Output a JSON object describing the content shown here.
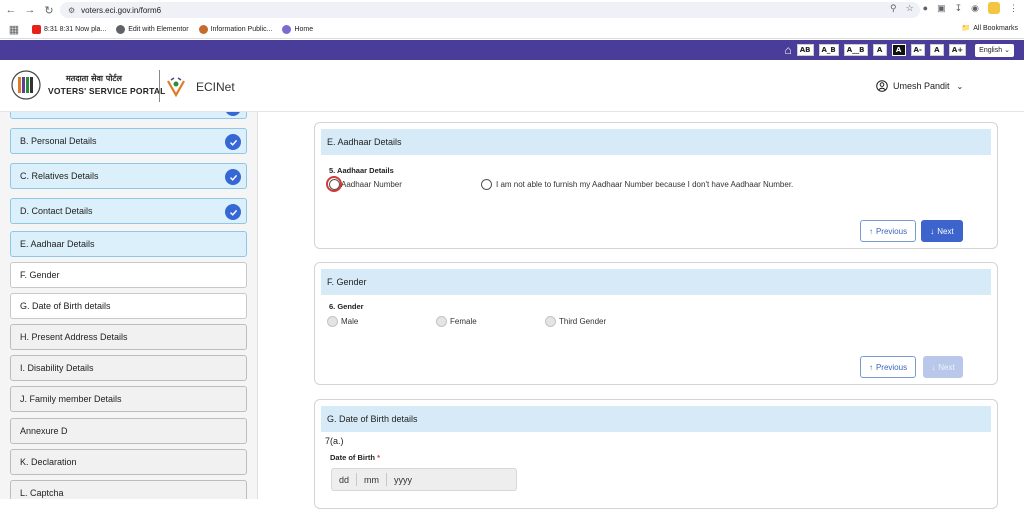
{
  "browser": {
    "url": "voters.eci.gov.in/form6",
    "bookmarks": [
      {
        "label": "8:31 8:31 Now pla...",
        "color": "#e62117"
      },
      {
        "label": "Edit with Elementor",
        "color": "#5f6368"
      },
      {
        "label": "Information Public...",
        "color": "#c56b2b"
      },
      {
        "label": "Home",
        "color": "#7a6bd0"
      }
    ],
    "all_bookmarks": "All Bookmarks"
  },
  "topbar": {
    "a11y_buttons": [
      "AB",
      "A_B",
      "A__B",
      "A",
      "A",
      "A-",
      "A",
      "A+"
    ],
    "language": "English"
  },
  "header": {
    "portal_hindi": "मतदाता सेवा पोर्टल",
    "portal_name": "VOTERS' SERVICE PORTAL",
    "ecinet": "ECINet",
    "user_name": "Umesh Pandit"
  },
  "sidebar": {
    "items": [
      {
        "label": "B. Personal Details",
        "state": "done"
      },
      {
        "label": "C. Relatives Details",
        "state": "done"
      },
      {
        "label": "D. Contact Details",
        "state": "done"
      },
      {
        "label": "E. Aadhaar Details",
        "state": "active"
      },
      {
        "label": "F. Gender",
        "state": "pending"
      },
      {
        "label": "G. Date of Birth details",
        "state": "pending"
      },
      {
        "label": "H. Present Address Details",
        "state": "plain"
      },
      {
        "label": "I. Disability Details",
        "state": "plain"
      },
      {
        "label": "J. Family member Details",
        "state": "plain"
      },
      {
        "label": "Annexure D",
        "state": "plain"
      },
      {
        "label": "K. Declaration",
        "state": "plain"
      },
      {
        "label": "L. Captcha",
        "state": "plain"
      }
    ]
  },
  "aadhaar": {
    "title": "E. Aadhaar Details",
    "question": "5. Aadhaar Details",
    "option1": "Aadhaar Number",
    "option2": "I am not able to furnish my Aadhaar Number because I don't have Aadhaar Number.",
    "prev": "Previous",
    "next": "Next"
  },
  "gender": {
    "title": "F. Gender",
    "question": "6. Gender",
    "options": [
      "Male",
      "Female",
      "Third Gender"
    ],
    "prev": "Previous",
    "next": "Next"
  },
  "dob": {
    "title": "G. Date of Birth details",
    "section_no": "7(a.)",
    "label": "Date of Birth",
    "required_mark": "*",
    "placeholders": [
      "dd",
      "mm",
      "yyyy"
    ]
  }
}
